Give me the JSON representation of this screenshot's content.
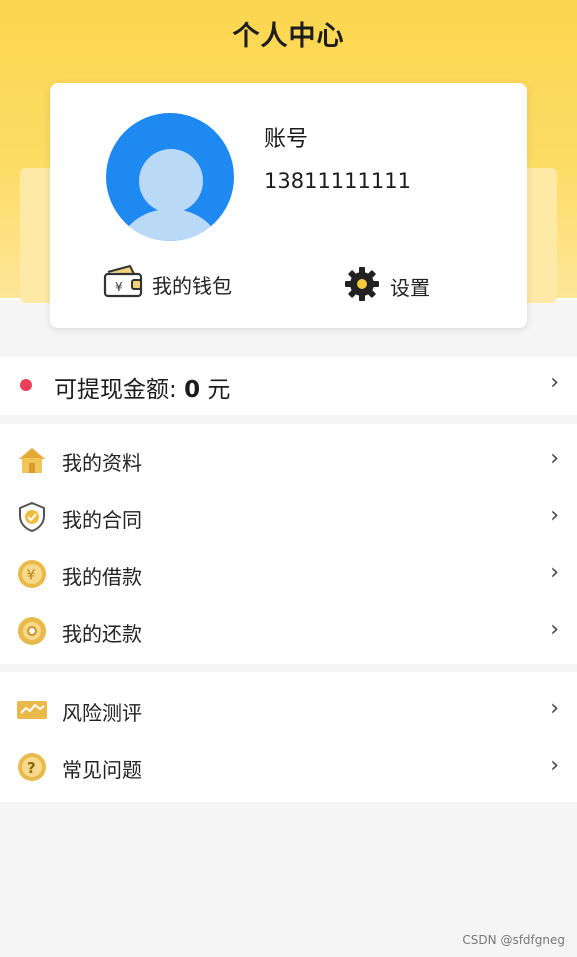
{
  "header": {
    "title": "个人中心"
  },
  "profile": {
    "account_label": "账号",
    "phone": "13811111111",
    "actions": [
      {
        "label": "我的钱包",
        "icon": "wallet-icon"
      },
      {
        "label": "设置",
        "icon": "gear-icon"
      }
    ]
  },
  "withdraw": {
    "label": "可提现金额: ",
    "amount": "0",
    "unit": " 元",
    "chevron": "›"
  },
  "menu_group_1": [
    {
      "label": "我的资料",
      "icon": "house-icon"
    },
    {
      "label": "我的合同",
      "icon": "shield-check-icon"
    },
    {
      "label": "我的借款",
      "icon": "yen-coin-icon"
    },
    {
      "label": "我的还款",
      "icon": "coin-icon"
    }
  ],
  "menu_group_2": [
    {
      "label": "风险测评",
      "icon": "chart-card-icon"
    },
    {
      "label": "常见问题",
      "icon": "question-icon"
    }
  ],
  "chevron": "›",
  "watermark": "CSDN @sfdfgneg",
  "colors": {
    "header_yellow": "#fbd64e",
    "avatar_blue": "#1e8af1",
    "dot_red": "#e8405a",
    "icon_gold": "#e9b949"
  }
}
